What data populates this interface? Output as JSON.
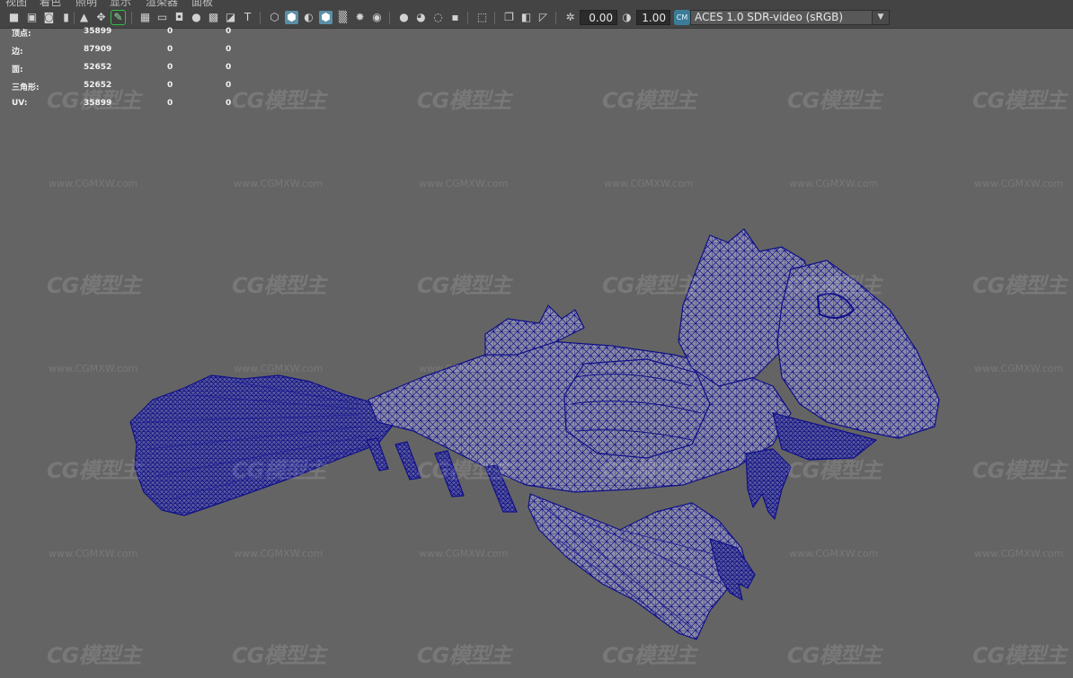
{
  "menu": {
    "items": [
      "视图",
      "着色",
      "照明",
      "显示",
      "渲染器",
      "面板"
    ]
  },
  "toolbar": {
    "exposure_value": "0.00",
    "gamma_value": "1.00",
    "color_space_badge": "CM",
    "color_space": "ACES 1.0 SDR-video (sRGB)",
    "icons": [
      "camera-icon",
      "camera-lock-icon",
      "camera-attributes-icon",
      "bookmark-icon",
      "image-plane-icon",
      "2d-pan-zoom-icon",
      "grease-pencil-icon",
      "grid-icon",
      "film-gate-icon",
      "resolution-gate-icon",
      "gate-mask-icon",
      "field-chart-icon",
      "safe-action-icon",
      "safe-title-icon",
      "wireframe-icon",
      "smooth-shade-icon",
      "shade-lit-icon",
      "wireframe-on-shaded-icon",
      "xray-icon",
      "use-default-light-icon",
      "shadows-icon",
      "screen-space-ao-icon",
      "motion-blur-icon",
      "anti-alias-icon",
      "depth-of-field-icon",
      "isolate-select-icon",
      "xray-joints-icon",
      "xray-active-icon",
      "backface-culling-icon",
      "exposure-icon",
      "gamma-icon"
    ]
  },
  "hud": {
    "rows": [
      {
        "label": "顶点:",
        "total": "35899",
        "selected": "0",
        "uv": "0"
      },
      {
        "label": "边:",
        "total": "87909",
        "selected": "0",
        "uv": "0"
      },
      {
        "label": "面:",
        "total": "52652",
        "selected": "0",
        "uv": "0"
      },
      {
        "label": "三角形:",
        "total": "52652",
        "selected": "0",
        "uv": "0"
      },
      {
        "label": "UV:",
        "total": "35899",
        "selected": "0",
        "uv": "0"
      }
    ]
  },
  "watermark": {
    "logo_text": "CG模型主",
    "url_text": "www.CGMXW.com"
  },
  "colors": {
    "viewport_bg": "#646464",
    "toolbar_bg": "#444444",
    "wire": "#10108a",
    "mesh_fill": "#8c8ca4",
    "active_icon": "#5c8fa6",
    "highlight": "#2fbf4a"
  }
}
